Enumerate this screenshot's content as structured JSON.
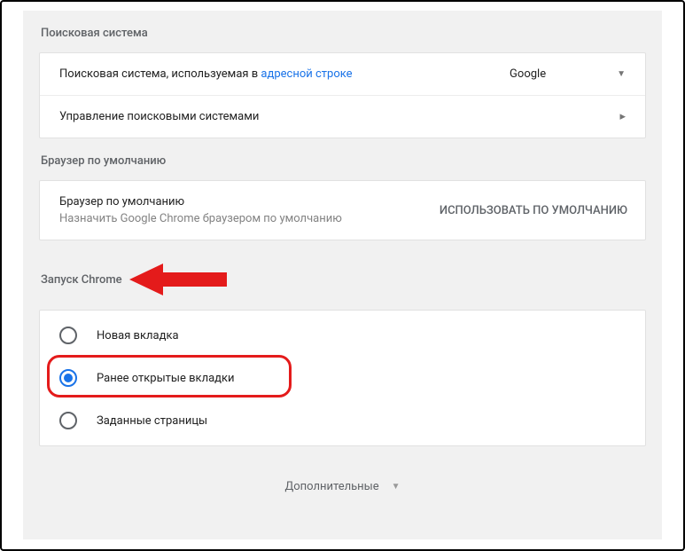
{
  "searchEngine": {
    "header": "Поисковая система",
    "usedInLabel": "Поисковая система, используемая в ",
    "addressBarLink": "адресной строке",
    "selected": "Google",
    "manageLabel": "Управление поисковыми системами"
  },
  "defaultBrowser": {
    "header": "Браузер по умолчанию",
    "title": "Браузер по умолчанию",
    "subtitle": "Назначить Google Chrome браузером по умолчанию",
    "button": "ИСПОЛЬЗОВАТЬ ПО УМОЛЧАНИЮ"
  },
  "startup": {
    "header": "Запуск Chrome",
    "options": {
      "newTab": "Новая вкладка",
      "previous": "Ранее открытые вкладки",
      "specific": "Заданные страницы"
    }
  },
  "footer": {
    "advanced": "Дополнительные"
  }
}
